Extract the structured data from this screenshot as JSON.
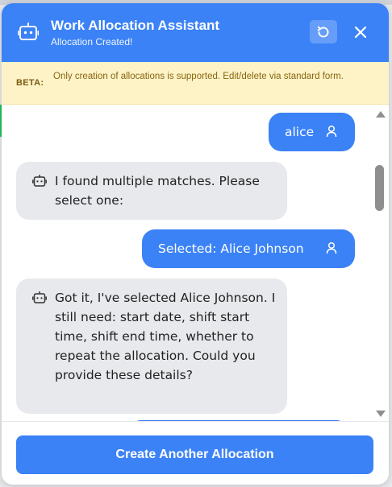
{
  "colors": {
    "primary": "#3b82f6",
    "bot_bubble": "#e8e9ec",
    "beta_bg": "#fdf3c7",
    "beta_text": "#8a6510"
  },
  "header": {
    "title": "Work Allocation Assistant",
    "subtitle": "Allocation Created!",
    "icons": [
      "bot-icon",
      "reset-icon",
      "close-icon"
    ]
  },
  "beta": {
    "label": "BETA:",
    "text": "Only creation of allocations is supported. Edit/delete via standard form."
  },
  "messages": [
    {
      "role": "user",
      "text": "alice",
      "icon": "user-icon"
    },
    {
      "role": "bot",
      "text": "I found multiple matches. Please select one:",
      "icon": "bot-icon"
    },
    {
      "role": "user",
      "text": "Selected: Alice Johnson",
      "icon": "user-icon"
    },
    {
      "role": "bot",
      "text": "Got it, I've selected Alice Johnson. I still need: start date, shift start time, shift end time, whether to repeat the allocation. Could you provide these details?",
      "icon": "bot-icon"
    }
  ],
  "footer": {
    "button_label": "Create Another Allocation"
  }
}
